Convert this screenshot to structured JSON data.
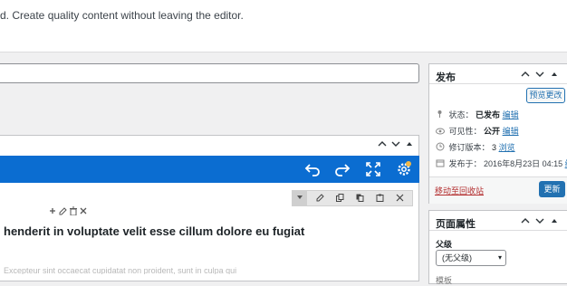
{
  "notice": {
    "text": "d. Create quality content without leaving the editor."
  },
  "editor": {
    "headline": "henderit in voluptate velit esse cillum dolore eu fugiat",
    "faded_text": "Excepteur sint occaecat cupidatat non proident, sunt in culpa qui"
  },
  "publish": {
    "title": "发布",
    "preview_label": "预览更改",
    "status_label": "状态：",
    "status_value": "已发布",
    "status_edit": "编辑",
    "visibility_label": "可见性：",
    "visibility_value": "公开",
    "visibility_edit": "编辑",
    "revisions_label": "修订版本：",
    "revisions_value": "3",
    "revisions_browse": "浏览",
    "published_label": "发布于：",
    "published_value": "2016年8月23日 04:15",
    "published_edit": "编辑",
    "trash_label": "移动至回收站",
    "update_label": "更新"
  },
  "page_attributes": {
    "title": "页面属性",
    "parent_label": "父级",
    "parent_value": "(无父级)",
    "next_label": "模板"
  },
  "colors": {
    "blue_bar": "#0b6dd1",
    "primary": "#2271b1",
    "trash": "#b32d2e"
  }
}
